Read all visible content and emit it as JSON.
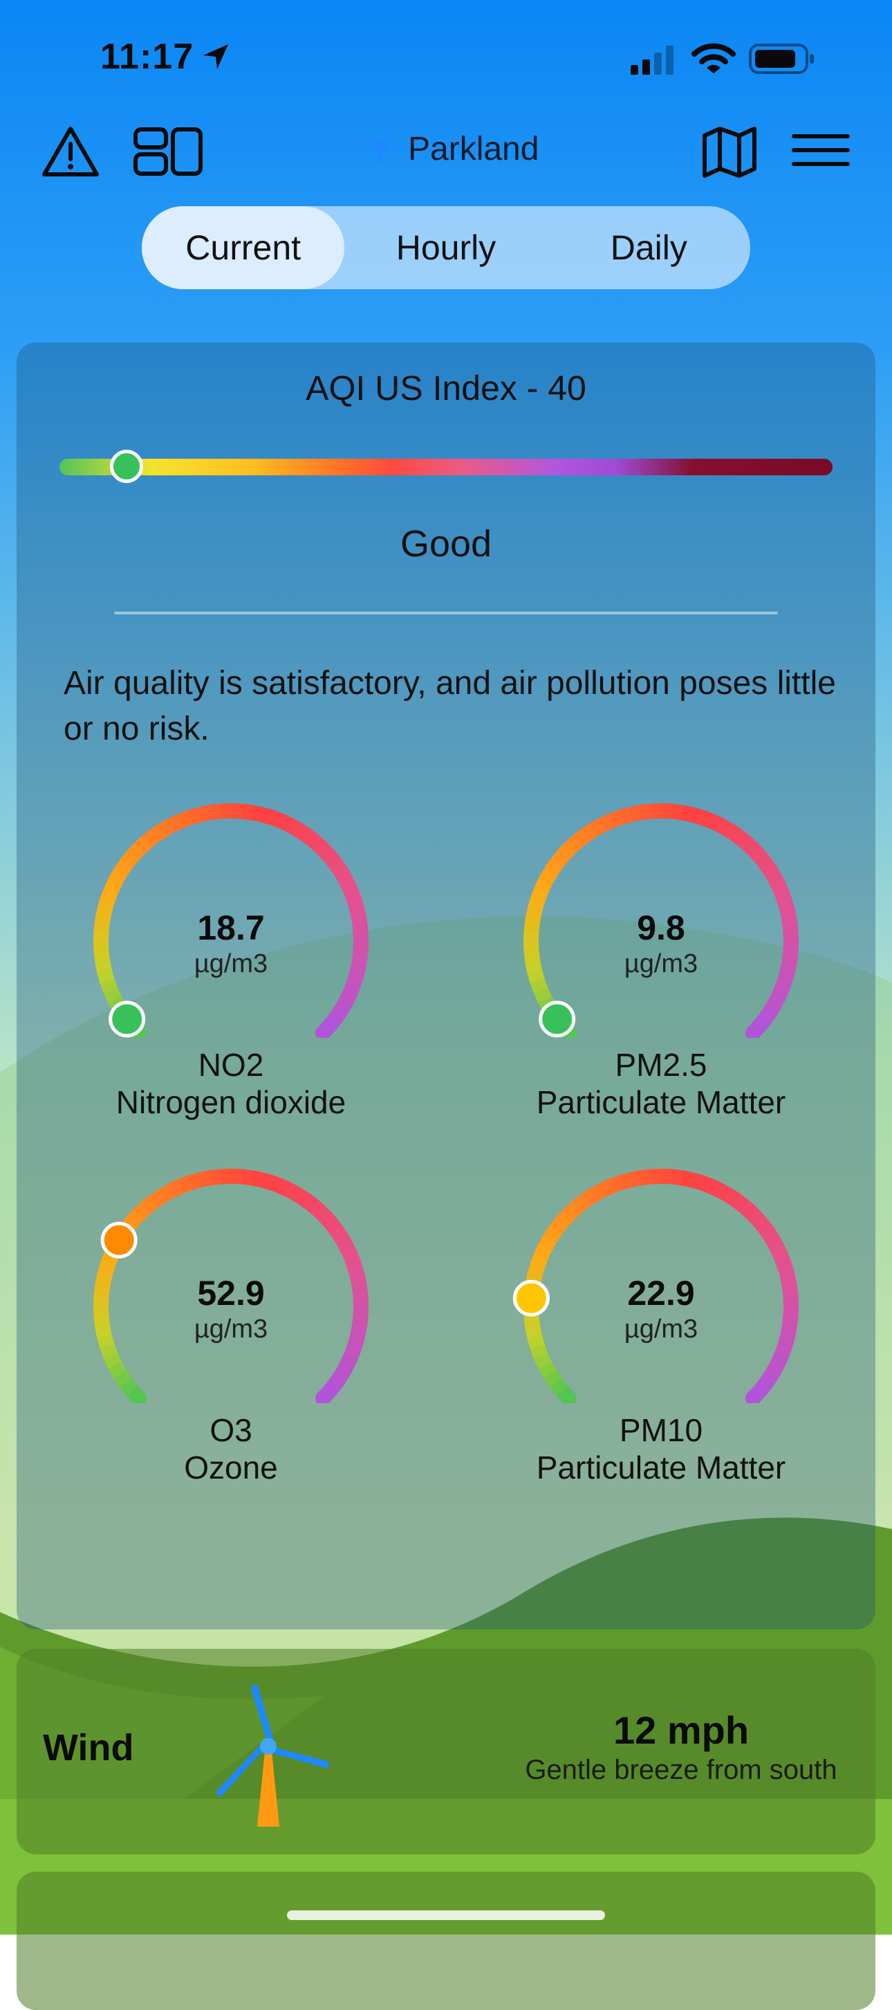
{
  "status_bar": {
    "time": "11:17"
  },
  "nav": {
    "location": "Parkland",
    "icons": [
      "warning-icon",
      "layout-icon",
      "location-arrow-icon",
      "map-icon",
      "menu-icon"
    ]
  },
  "tabs": [
    {
      "label": "Current",
      "selected": true
    },
    {
      "label": "Hourly",
      "selected": false
    },
    {
      "label": "Daily",
      "selected": false
    }
  ],
  "aqi": {
    "title": "AQI US Index - 40",
    "value": 40,
    "level": "Good",
    "description": "Air quality is satisfactory, and air pollution poses little or no risk."
  },
  "pollutants": [
    {
      "value": "18.7",
      "unit": "µg/m3",
      "code": "NO2",
      "name": "Nitrogen dioxide",
      "level": 0.03,
      "dot_color": "#38c15a"
    },
    {
      "value": "9.8",
      "unit": "µg/m3",
      "code": "PM2.5",
      "name": "Particulate Matter",
      "level": 0.03,
      "dot_color": "#38c15a"
    },
    {
      "value": "52.9",
      "unit": "µg/m3",
      "code": "O3",
      "name": "Ozone",
      "level": 0.28,
      "dot_color": "#ff8a00"
    },
    {
      "value": "22.9",
      "unit": "µg/m3",
      "code": "PM10",
      "name": "Particulate Matter",
      "level": 0.18,
      "dot_color": "#ffc600"
    }
  ],
  "wind": {
    "title": "Wind",
    "speed": "12 mph",
    "description": "Gentle breeze from south"
  },
  "colors": {
    "sky_top": "#1287f3",
    "grass": "#5e9a2a",
    "accent": "#1e88ff"
  }
}
